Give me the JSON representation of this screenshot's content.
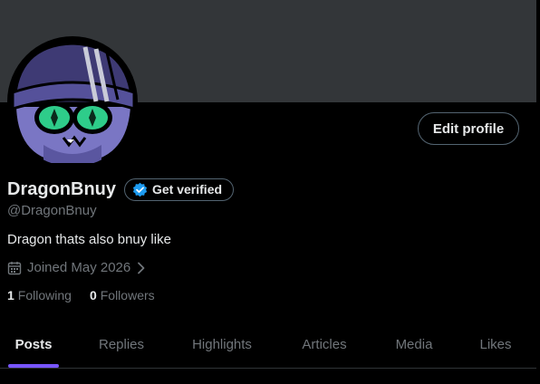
{
  "profile": {
    "display_name": "DragonBnuy",
    "handle": "@DragonBnuy",
    "bio": "Dragon thats also bnuy like",
    "joined": "Joined May 2026"
  },
  "actions": {
    "edit_profile": "Edit profile",
    "get_verified": "Get verified"
  },
  "stats": {
    "following_count": "1",
    "following_label": "Following",
    "followers_count": "0",
    "followers_label": "Followers"
  },
  "tabs": [
    {
      "label": "Posts",
      "active": true
    },
    {
      "label": "Replies",
      "active": false
    },
    {
      "label": "Highlights",
      "active": false
    },
    {
      "label": "Articles",
      "active": false
    },
    {
      "label": "Media",
      "active": false
    },
    {
      "label": "Likes",
      "active": false
    }
  ],
  "icons": {
    "verified": "verified-badge-icon",
    "calendar": "calendar-icon",
    "chevron": "chevron-right-icon"
  },
  "colors": {
    "banner": "#333639",
    "accent_blue": "#1d9bf0",
    "tab_indicator": "#7856ff",
    "secondary_text": "#71767b",
    "primary_text": "#e7e9ea"
  }
}
